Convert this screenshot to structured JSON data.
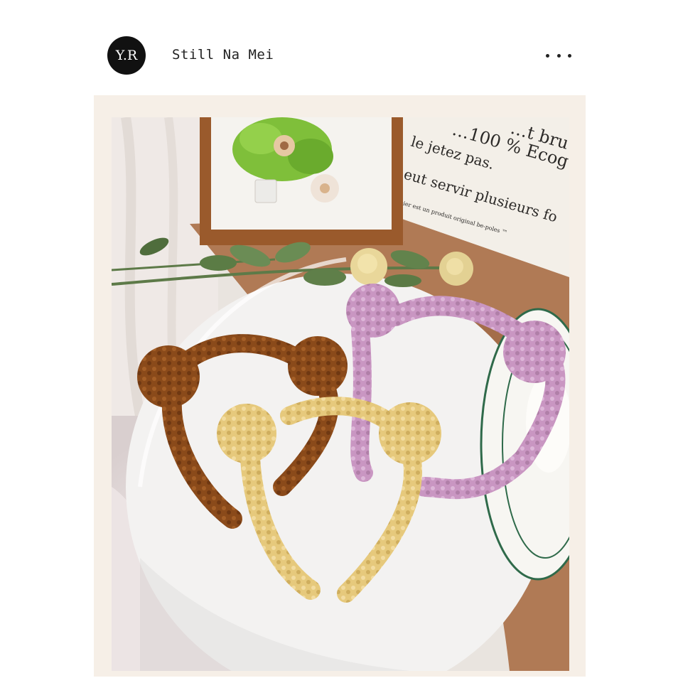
{
  "post": {
    "avatar_text": "Y.R",
    "username": "Still Na Mei",
    "more_icon": "more-horizontal-icon"
  },
  "photo": {
    "subject": "product-photo",
    "card_text": [
      "…t bru",
      "…100 % Ecog",
      "le jetez pas.",
      "eut servir plusieurs fo",
      "pier est un produit original be-poles ™"
    ]
  },
  "colors": {
    "frame_bg": "#f6efe7",
    "avatar_bg": "#111111",
    "brown_headband": "#8a4a1a",
    "yellow_headband": "#e9cf86",
    "pink_headband": "#cfa0c8",
    "table": "#f3f2f1",
    "cloth": "#b07a55"
  }
}
